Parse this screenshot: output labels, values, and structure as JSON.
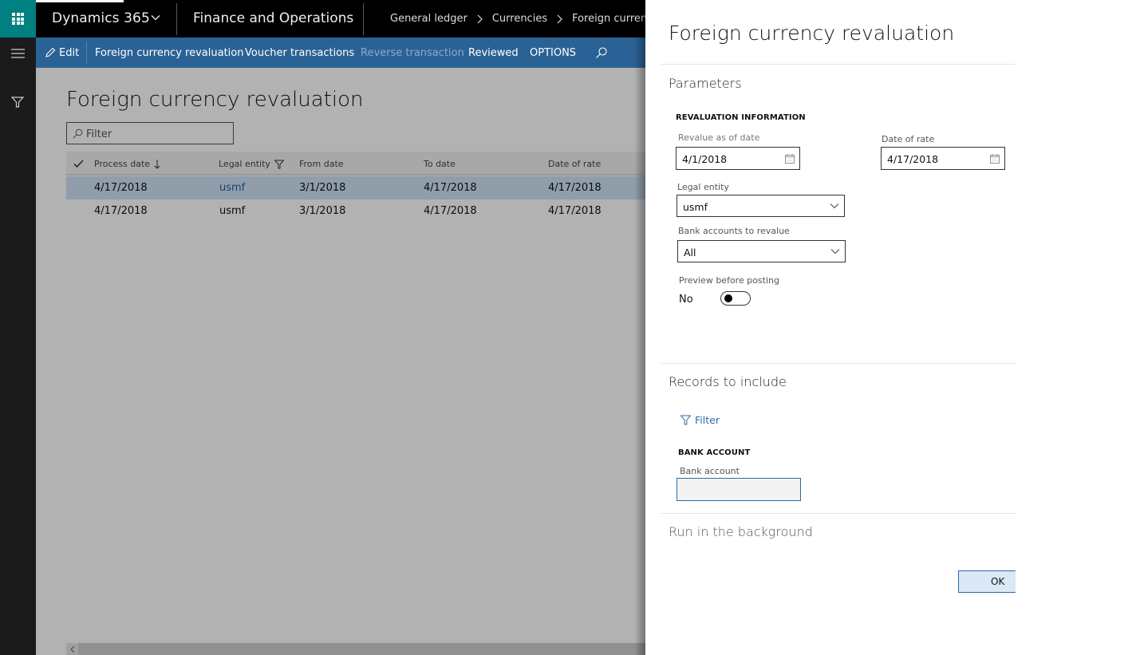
{
  "app": {
    "brand": "Dynamics 365",
    "module": "Finance and Operations",
    "breadcrumb": [
      "General ledger",
      "Currencies",
      "Foreign currency r"
    ]
  },
  "actionbar": {
    "edit": "Edit",
    "items": [
      {
        "label": "Foreign currency revaluation",
        "enabled": true
      },
      {
        "label": "Voucher transactions",
        "enabled": true
      },
      {
        "label": "Reverse transaction",
        "enabled": false
      },
      {
        "label": "Reviewed",
        "enabled": true
      },
      {
        "label": "OPTIONS",
        "enabled": true
      }
    ]
  },
  "page": {
    "title": "Foreign currency revaluation",
    "filter_placeholder": "Filter"
  },
  "grid": {
    "columns": [
      "Process date",
      "Legal entity",
      "From date",
      "To date",
      "Date of rate"
    ],
    "rows": [
      {
        "process_date": "4/17/2018",
        "legal_entity": "usmf",
        "from_date": "3/1/2018",
        "to_date": "4/17/2018",
        "date_of_rate": "4/17/2018",
        "selected": true
      },
      {
        "process_date": "4/17/2018",
        "legal_entity": "usmf",
        "from_date": "3/1/2018",
        "to_date": "4/17/2018",
        "date_of_rate": "4/17/2018",
        "selected": false
      }
    ]
  },
  "dialog": {
    "title": "Foreign currency revaluation",
    "parameters": {
      "section_title": "Parameters",
      "group_title": "REVALUATION INFORMATION",
      "revalue_as_of_date": {
        "label": "Revalue as of date",
        "value": "4/1/2018"
      },
      "date_of_rate": {
        "label": "Date of rate",
        "value": "4/17/2018"
      },
      "legal_entity": {
        "label": "Legal entity",
        "value": "usmf"
      },
      "bank_accounts": {
        "label": "Bank accounts to revalue",
        "value": "All"
      },
      "preview_before_posting": {
        "label": "Preview before posting",
        "value": "No"
      }
    },
    "records": {
      "section_title": "Records to include",
      "filter_label": "Filter",
      "group_title": "BANK ACCOUNT",
      "bank_account": {
        "label": "Bank account",
        "value": ""
      }
    },
    "background": {
      "section_title": "Run in the background"
    },
    "ok_label": "OK"
  },
  "colors": {
    "accent": "#2b6296",
    "waffle": "#008080",
    "link": "#2b6aab"
  }
}
